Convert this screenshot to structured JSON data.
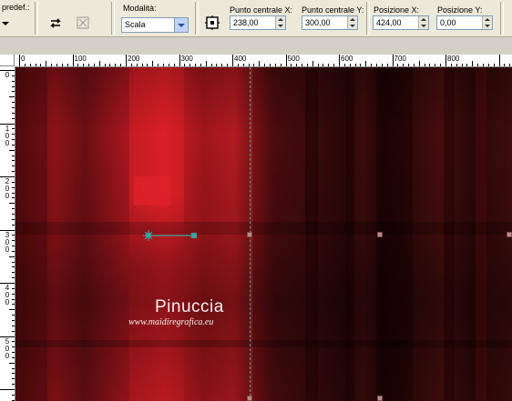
{
  "toolbar": {
    "preset_label": "predef.:",
    "mode_label": "Modalità:",
    "mode_value": "Scala",
    "center_x_label": "Punto centrale X:",
    "center_x_value": "238,00",
    "center_y_label": "Punto centrale Y:",
    "center_y_value": "300,00",
    "pos_x_label": "Posizione X:",
    "pos_x_value": "424,00",
    "pos_y_label": "Posizione Y:",
    "pos_y_value": "0,00"
  },
  "ruler_h": {
    "labels": [
      "0",
      "100",
      "200",
      "300",
      "400",
      "500",
      "600",
      "700",
      "800"
    ]
  },
  "ruler_v": {
    "labels": [
      "0",
      "100",
      "200",
      "300",
      "400",
      "500"
    ]
  },
  "canvas": {
    "watermark_title": "Pinuccia",
    "watermark_url": "www.maidiregrafica.eu"
  },
  "icons": [
    "swap-arrows-icon",
    "deform-reset-icon",
    "center-point-icon"
  ],
  "colors": {
    "accent_handle": "#3aa3a0",
    "canvas_red": "#d21d24"
  }
}
